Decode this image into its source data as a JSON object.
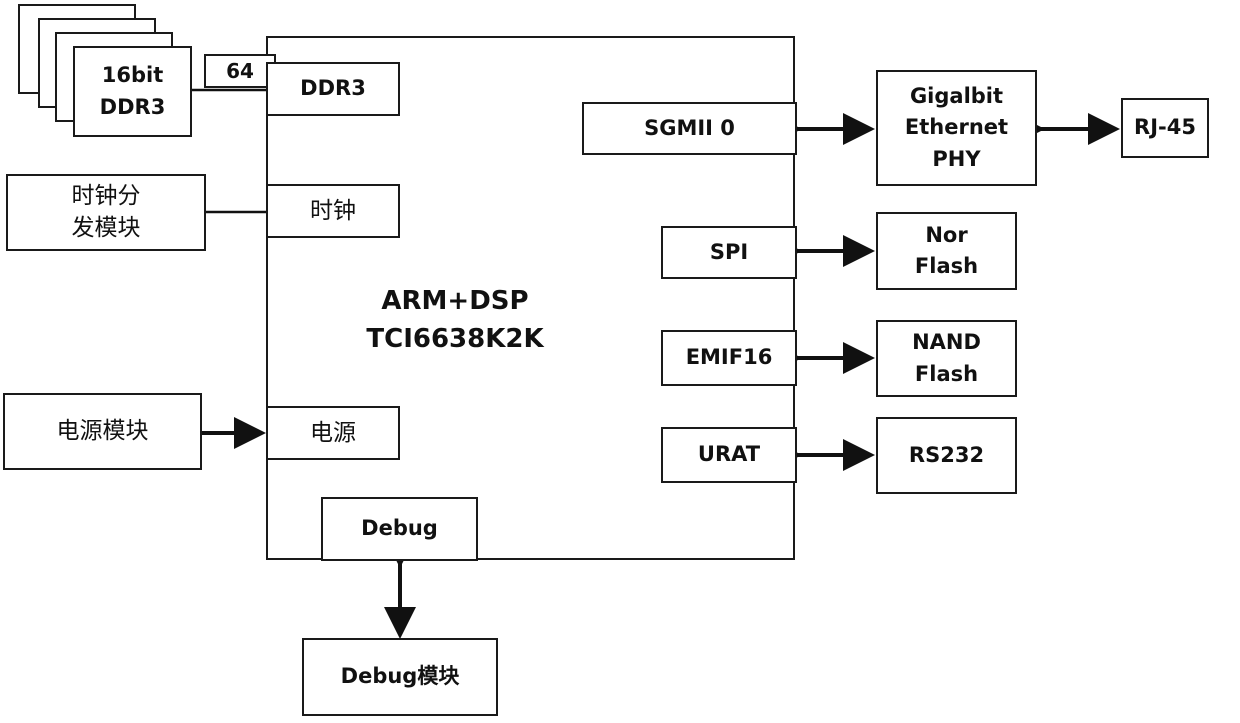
{
  "diagram": {
    "processor": {
      "line1": "ARM+DSP",
      "line2": "TCI6638K2K"
    },
    "memory": {
      "line1": "16bit",
      "line2": "DDR3",
      "bus_width": "64",
      "port": "DDR3"
    },
    "clock": {
      "module_line1": "时钟分",
      "module_line2": "发模块",
      "port": "时钟"
    },
    "power": {
      "module": "电源模块",
      "port": "电源"
    },
    "debug": {
      "port": "Debug",
      "module": "Debug模块"
    },
    "ethernet": {
      "port": "SGMII 0",
      "phy_line1": "Gigalbit",
      "phy_line2": "Ethernet",
      "phy_line3": "PHY",
      "connector": "RJ-45"
    },
    "spi": {
      "port": "SPI",
      "dev_line1": "Nor",
      "dev_line2": "Flash"
    },
    "emif": {
      "port": "EMIF16",
      "dev_line1": "NAND",
      "dev_line2": "Flash"
    },
    "uart": {
      "port": "URAT",
      "dev": "RS232"
    }
  }
}
